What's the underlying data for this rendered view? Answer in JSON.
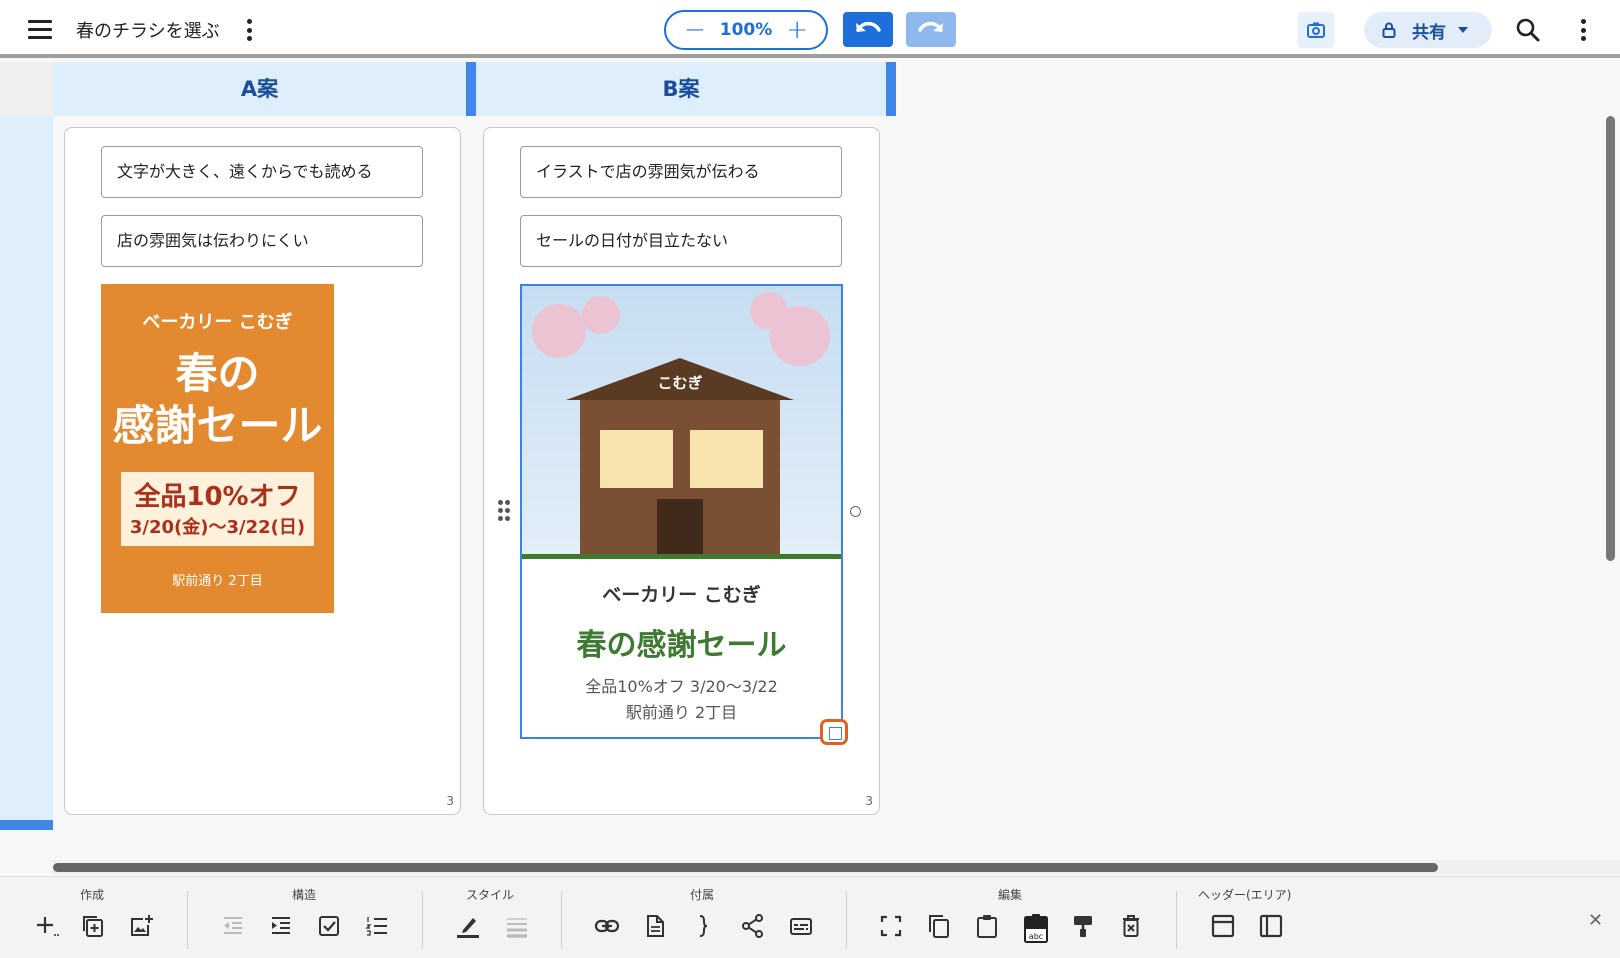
{
  "header": {
    "title": "春のチラシを選ぶ",
    "zoom": {
      "minus": "−",
      "value": "100%",
      "plus": "+"
    },
    "share_label": "共有"
  },
  "columns": [
    {
      "header": "A案",
      "notes": [
        "文字が大きく、遠くからでも読める",
        "店の雰囲気は伝わりにくい"
      ],
      "flyer": {
        "store": "ベーカリー こむぎ",
        "headline_line1": "春の",
        "headline_line2": "感謝セール",
        "discount": "全品10%オフ",
        "dates": "3/20(金)〜3/22(日)",
        "address": "駅前通り 2丁目",
        "bg_color": "#e3892f"
      },
      "page_number": "3"
    },
    {
      "header": "B案",
      "notes": [
        "イラストで店の雰囲気が伝わる",
        "セールの日付が目立たない"
      ],
      "flyer": {
        "roof_label": "こむぎ",
        "store": "ベーカリー こむぎ",
        "headline": "春の感謝セール",
        "info_line1": "全品10%オフ  3/20〜3/22",
        "info_line2": "駅前通り 2丁目",
        "accent_color": "#3e7a30"
      },
      "page_number": "3"
    }
  ],
  "toolbar": {
    "groups": [
      {
        "title": "作成",
        "tools": [
          "add-icon",
          "duplicate-icon",
          "add-image-icon"
        ]
      },
      {
        "title": "構造",
        "tools": [
          "outdent-icon",
          "indent-icon",
          "checkbox-icon",
          "numbered-list-icon"
        ]
      },
      {
        "title": "スタイル",
        "tools": [
          "highlighter-icon",
          "line-style-icon"
        ]
      },
      {
        "title": "付属",
        "tools": [
          "link-icon",
          "document-icon",
          "brace-icon",
          "share-node-icon",
          "caption-icon"
        ]
      },
      {
        "title": "編集",
        "tools": [
          "select-all-icon",
          "copy-icon",
          "paste-icon",
          "paste-text-icon",
          "format-paint-icon",
          "delete-icon"
        ]
      },
      {
        "title": "ヘッダー(エリア)",
        "tools": [
          "header-top-icon",
          "header-left-icon"
        ]
      }
    ],
    "paste_text_badge": "abc"
  },
  "colors": {
    "accent": "#1e6fd9",
    "header_bg": "#dfeefb",
    "selection": "#e0601e"
  }
}
